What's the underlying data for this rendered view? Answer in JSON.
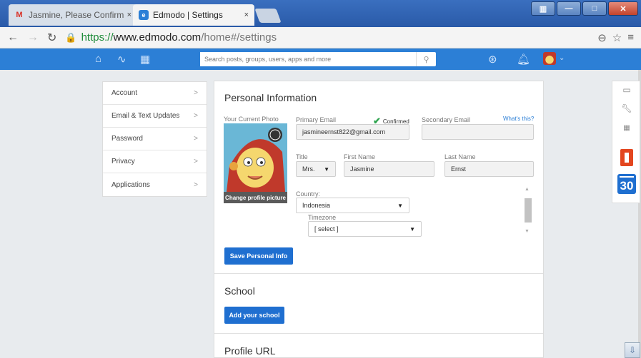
{
  "browser": {
    "tabs": [
      {
        "label": "Jasmine, Please Confirm Y",
        "favicon": "gmail-icon",
        "active": false
      },
      {
        "label": "Edmodo | Settings",
        "favicon": "edmodo-icon",
        "active": true
      }
    ],
    "tab_close": "×",
    "url_scheme": "https://",
    "url_host": "www.edmodo.com",
    "url_path": "/home#/settings"
  },
  "app": {
    "search_placeholder": "Search posts, groups, users, apps and more",
    "accent": "#2c7fd6"
  },
  "leftnav": {
    "items": [
      {
        "label": "Account"
      },
      {
        "label": "Email & Text Updates"
      },
      {
        "label": "Password"
      },
      {
        "label": "Privacy"
      },
      {
        "label": "Applications"
      }
    ],
    "chevron": ">"
  },
  "personal_info": {
    "title": "Personal Information",
    "photo_label": "Your Current Photo",
    "change_photo": "Change profile picture",
    "primary_email_label": "Primary Email",
    "primary_email": "jasmineernst822@gmail.com",
    "confirmed": "Confirmed",
    "secondary_email_label": "Secondary Email",
    "secondary_email": "",
    "whats_this": "What's this?",
    "title_label": "Title",
    "title_value": "Mrs.",
    "first_name_label": "First Name",
    "first_name": "Jasmine",
    "last_name_label": "Last Name",
    "last_name": "Ernst",
    "country_label": "Country:",
    "country": "Indonesia",
    "timezone_label": "Timezone",
    "timezone": "[ select ]",
    "save_button": "Save Personal Info"
  },
  "school": {
    "title": "School",
    "add_button": "Add your school"
  },
  "profile_url": {
    "title": "Profile URL"
  },
  "right_toolbar": {
    "calendar_day": "30"
  }
}
